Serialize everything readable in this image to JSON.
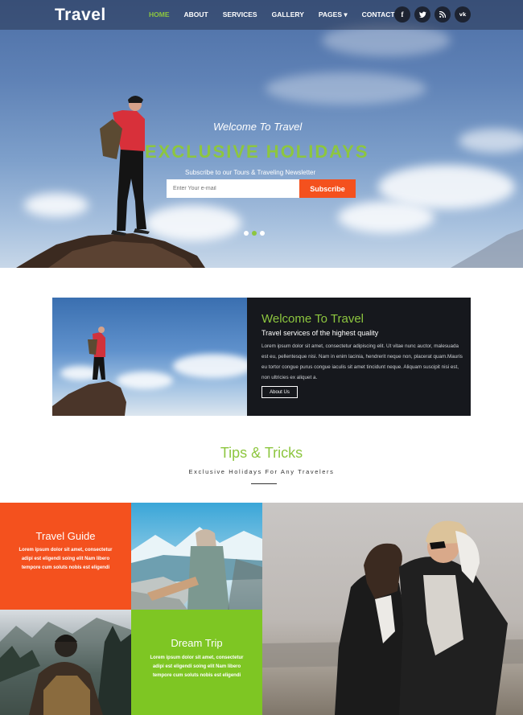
{
  "nav": {
    "logo": "Travel",
    "items": [
      {
        "label": "HOME",
        "active": true
      },
      {
        "label": "ABOUT",
        "active": false
      },
      {
        "label": "SERVICES",
        "active": false
      },
      {
        "label": "GALLERY",
        "active": false
      },
      {
        "label": "PAGES ▾",
        "active": false
      },
      {
        "label": "CONTACT",
        "active": false
      }
    ],
    "socials": [
      "f",
      "t",
      "rss",
      "vk"
    ]
  },
  "hero": {
    "welcome": "Welcome To Travel",
    "title": "EXCLUSIVE HOLIDAYS",
    "newsletter": "Subscribe to our Tours & Traveling Newsletter",
    "email_placeholder": "Enter Your e-mail",
    "subscribe_label": "Subscribe",
    "slide_count": 3,
    "active_slide": 2
  },
  "welcome": {
    "title": "Welcome To Travel",
    "subtitle": "Travel services of the highest quality",
    "text": "Lorem ipsum dolor sit amet, consectetur adipiscing elit. Ut vitae nunc auctor, malesuada est eu, pellentesque nisi. Nam in enim lacinia, hendrerit neque non, placerat quam.Mauris eu tortor congue purus congue iaculis sit amet tincidunt neque. Aliquam suscipit nisi est, non ultricies ex aliquet a.",
    "button": "About Us"
  },
  "tips": {
    "title": "Tips & Tricks",
    "subtitle": "Exclusive Holidays For Any Travelers"
  },
  "grid": {
    "guide_title": "Travel Guide",
    "guide_text": "Lorem ipsum dolor sit amet, consectetur adipi est eligendi soing elit Nam libero tempore cum soluts nobis est eligendi",
    "trip_title": "Dream Trip",
    "trip_text": "Lorem ipsum dolor sit amet, consectetur adipi est eligendi soing elit Nam libero tempore cum soluts nobis est eligendi"
  },
  "colors": {
    "accent_green": "#8dc63f",
    "accent_orange": "#f4511e",
    "dark": "#16181d"
  }
}
